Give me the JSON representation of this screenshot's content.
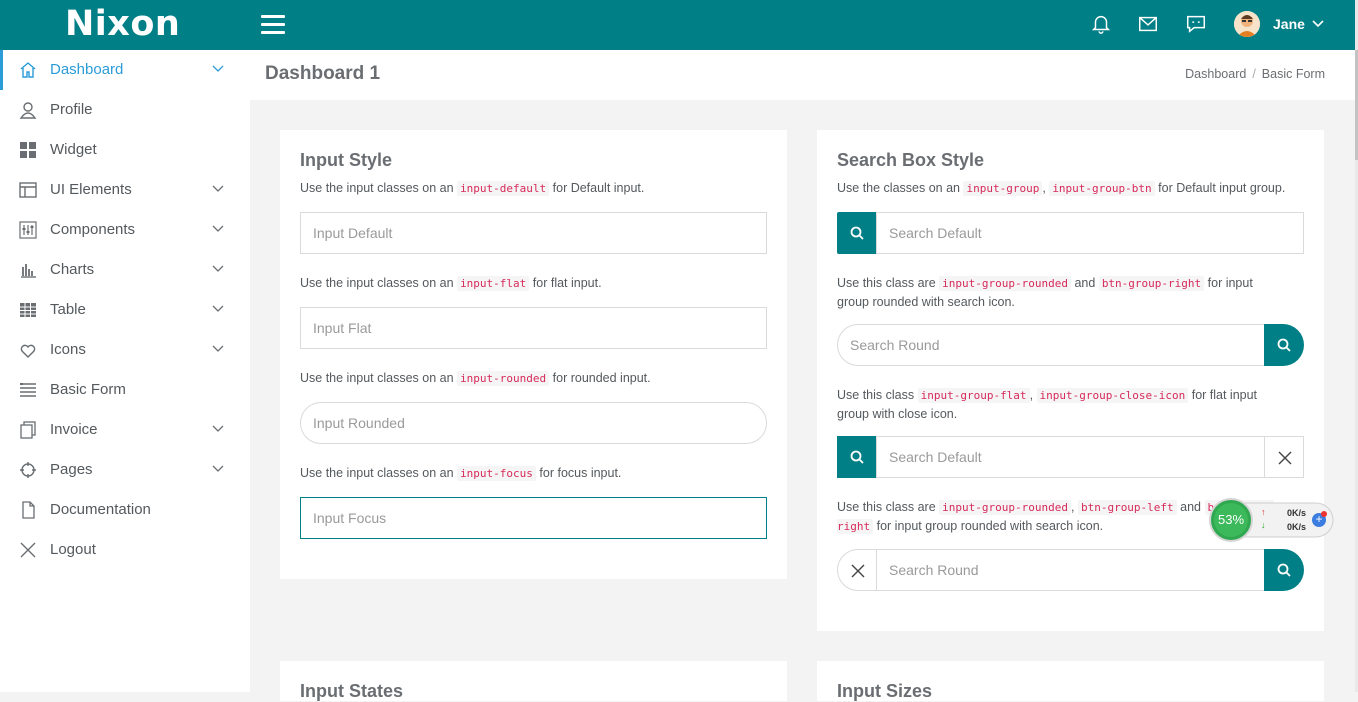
{
  "header": {
    "logo": "Nixon",
    "username": "Jane"
  },
  "sidebar": {
    "items": [
      {
        "label": "Dashboard",
        "icon": "home-icon",
        "active": true,
        "has_chevron": true
      },
      {
        "label": "Profile",
        "icon": "user-icon",
        "has_chevron": false
      },
      {
        "label": "Widget",
        "icon": "grid-icon",
        "has_chevron": false
      },
      {
        "label": "UI Elements",
        "icon": "layout-icon",
        "has_chevron": true
      },
      {
        "label": "Components",
        "icon": "sliders-icon",
        "has_chevron": true
      },
      {
        "label": "Charts",
        "icon": "bar-chart-icon",
        "has_chevron": true
      },
      {
        "label": "Table",
        "icon": "table-icon",
        "has_chevron": true
      },
      {
        "label": "Icons",
        "icon": "heart-icon",
        "has_chevron": true
      },
      {
        "label": "Basic Form",
        "icon": "form-icon",
        "has_chevron": false
      },
      {
        "label": "Invoice",
        "icon": "copy-icon",
        "has_chevron": true
      },
      {
        "label": "Pages",
        "icon": "crosshair-icon",
        "has_chevron": true
      },
      {
        "label": "Documentation",
        "icon": "file-icon",
        "has_chevron": false
      },
      {
        "label": "Logout",
        "icon": "close-icon",
        "has_chevron": false
      }
    ]
  },
  "page": {
    "title": "Dashboard 1",
    "breadcrumb": [
      "Dashboard",
      "Basic Form"
    ],
    "breadcrumb_sep": "/"
  },
  "input_style": {
    "title": "Input Style",
    "rows": [
      {
        "pre": "Use the input classes on an",
        "code": "input-default",
        "post": "for Default input.",
        "placeholder": "Input Default"
      },
      {
        "pre": "Use the input classes on an",
        "code": "input-flat",
        "post": "for flat input.",
        "placeholder": "Input Flat"
      },
      {
        "pre": "Use the input classes on an",
        "code": "input-rounded",
        "post": "for rounded input.",
        "placeholder": "Input Rounded"
      },
      {
        "pre": "Use the input classes on an",
        "code": "input-focus",
        "post": "for focus input.",
        "placeholder": "Input Focus"
      }
    ]
  },
  "search_style": {
    "title": "Search Box Style",
    "d1": {
      "pre": "Use the classes on an",
      "code1": "input-group",
      "sep": ",",
      "code2": "input-group-btn",
      "post": "for Default input group."
    },
    "s1": "Search Default",
    "d2": {
      "pre": "Use this class are",
      "code1": "input-group-rounded",
      "mid": "and",
      "code2": "btn-group-right",
      "post": "for input group rounded with search icon."
    },
    "s2": "Search Round",
    "d3": {
      "pre": "Use this class",
      "code1": "input-group-flat",
      "sep": ",",
      "code2": "input-group-close-icon",
      "post": "for flat input group with close icon."
    },
    "s3": "Search Default",
    "d4": {
      "pre": "Use this class are",
      "code1": "input-group-rounded",
      "sep": ",",
      "code2": "btn-group-left",
      "mid": "and",
      "code3": "btn-group-right",
      "post": "for input group rounded with search icon."
    },
    "s4": "Search Round"
  },
  "bottom_cards": {
    "left_title": "Input States",
    "right_title": "Input Sizes"
  },
  "net_widget": {
    "percent": "53%",
    "up": "0K/s",
    "down": "0K/s"
  },
  "colors": {
    "primary": "#007f86",
    "active_link": "#2b9cd8",
    "code": "#d72a5a"
  }
}
